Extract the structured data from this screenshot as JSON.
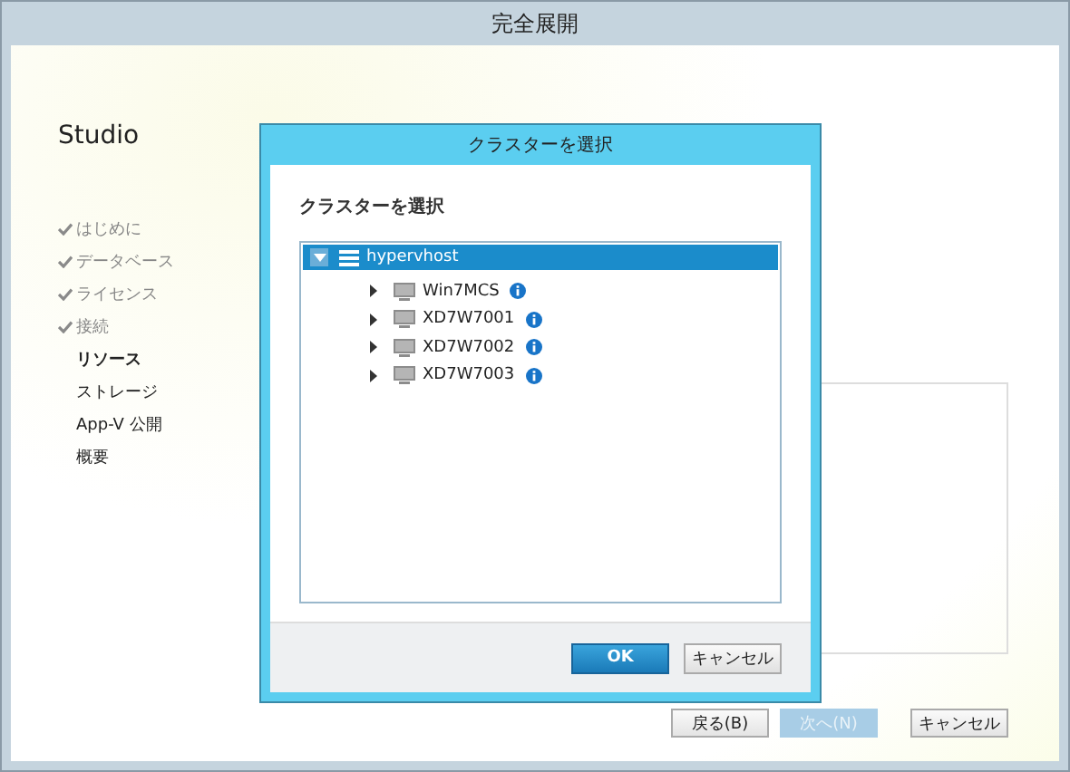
{
  "window": {
    "title": "完全展開"
  },
  "sidebar": {
    "title": "Studio",
    "items": [
      {
        "label": "はじめに",
        "completed": true,
        "selected": false
      },
      {
        "label": "データベース",
        "completed": true,
        "selected": false
      },
      {
        "label": "ライセンス",
        "completed": true,
        "selected": false
      },
      {
        "label": "接続",
        "completed": true,
        "selected": false
      },
      {
        "label": "リソース",
        "completed": false,
        "selected": true
      },
      {
        "label": "ストレージ",
        "completed": false,
        "selected": false
      },
      {
        "label": "App-V 公開",
        "completed": false,
        "selected": false
      },
      {
        "label": "概要",
        "completed": false,
        "selected": false
      }
    ]
  },
  "footer_buttons": [
    {
      "label": "戻る(B)",
      "disabled": false
    },
    {
      "label": "次へ(N)",
      "disabled": true
    },
    {
      "label": "キャンセル",
      "disabled": false
    }
  ],
  "dialog": {
    "title": "クラスターを選択",
    "label": "クラスターを選択",
    "tree": [
      {
        "label": "hypervhost",
        "expanded": true,
        "selected": true,
        "children": [
          {
            "label": "Win7MCS",
            "expanded": false,
            "selected": false
          },
          {
            "label": "XD7W7001",
            "expanded": false,
            "selected": false
          },
          {
            "label": "XD7W7002",
            "expanded": false,
            "selected": false
          },
          {
            "label": "XD7W7003",
            "expanded": false,
            "selected": false
          }
        ]
      }
    ],
    "buttons": [
      {
        "label": "OK",
        "default": true
      },
      {
        "label": "キャンセル",
        "default": false
      }
    ]
  }
}
